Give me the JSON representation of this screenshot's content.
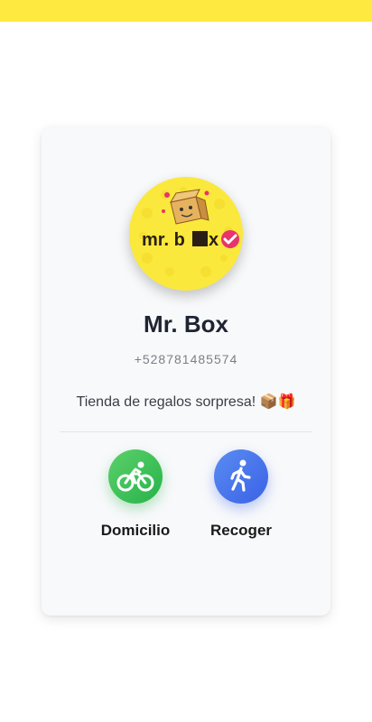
{
  "status_bar": {
    "color": "#fde93f"
  },
  "store": {
    "logo_text": "mr. box",
    "name": "Mr. Box",
    "phone": "+528781485574",
    "description": "Tienda de regalos sorpresa! 📦🎁"
  },
  "options": {
    "delivery": {
      "label": "Domicilio",
      "icon": "bicycle-icon",
      "color": "#2fb84e"
    },
    "pickup": {
      "label": "Recoger",
      "icon": "walking-person-icon",
      "color": "#4574ec"
    }
  }
}
